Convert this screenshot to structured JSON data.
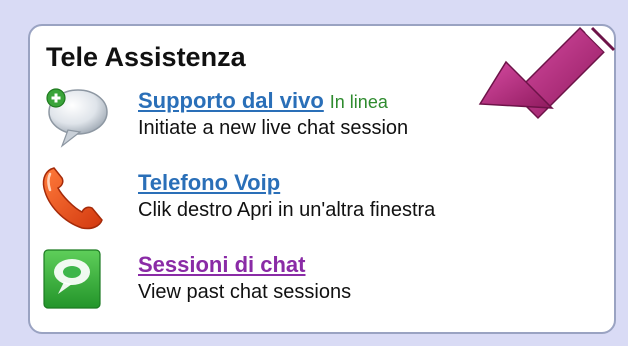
{
  "panel": {
    "title": "Tele Assistenza",
    "items": [
      {
        "link": "Supporto dal vivo",
        "status": "In linea",
        "description": "Initiate a new live chat session",
        "icon": "chat-bubble-icon"
      },
      {
        "link": "Telefono Voip",
        "description": "Clik destro Apri in un'altra finestra",
        "icon": "phone-icon"
      },
      {
        "link": "Sessioni di chat",
        "description": "View past chat sessions",
        "icon": "chat-sessions-icon"
      }
    ]
  },
  "colors": {
    "background": "#d9dbf5",
    "link": "#2a6fb8",
    "visited_link": "#8a2ba6",
    "status": "#2e8b2e",
    "arrow": "#b0287a"
  },
  "annotations": {
    "pointer_arrow": "arrow-icon"
  }
}
